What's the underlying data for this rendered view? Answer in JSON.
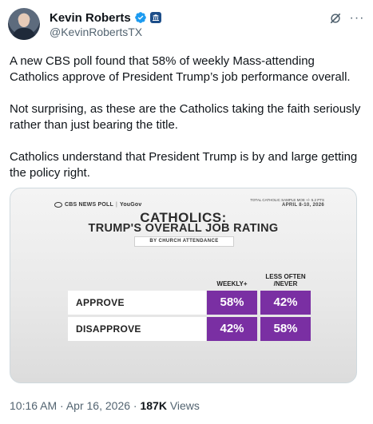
{
  "author": {
    "name": "Kevin Roberts",
    "handle": "@KevinRobertsTX"
  },
  "tweet": {
    "paragraphs": [
      "A new CBS poll found that 58% of weekly Mass-attending Catholics approve of President Trump’s job performance overall.",
      "Not surprising, as these are the Catholics taking the faith seriously rather than just bearing the title.",
      "Catholics understand that President Trump is by and large getting the policy right."
    ]
  },
  "media": {
    "brand": "CBS NEWS POLL",
    "brand_separator": "|",
    "partner": "YouGov",
    "moe": "TOTAL CATHOLIC SAMPLE MOE +/- 5.2 PTS",
    "date": "APRIL 8-10, 2026",
    "title_line1": "CATHOLICS:",
    "title_line2": "TRUMP'S OVERALL JOB RATING",
    "subtitle": "BY CHURCH ATTENDANCE",
    "columns": [
      "WEEKLY+",
      "LESS OFTEN /NEVER"
    ],
    "rows": [
      {
        "label": "APPROVE",
        "values": [
          "58%",
          "42%"
        ]
      },
      {
        "label": "DISAPPROVE",
        "values": [
          "42%",
          "58%"
        ]
      }
    ],
    "cell_color": "#7a2fa3"
  },
  "footer": {
    "time": "10:16 AM",
    "separator": "·",
    "date": "Apr 16, 2026",
    "views_count": "187K",
    "views_label": "Views"
  },
  "icons": {
    "verified": "verified-badge-icon",
    "government": "government-badge-icon",
    "grok": "grok-icon",
    "more": "more-icon"
  },
  "colors": {
    "verified": "#1d9bf0",
    "muted_text": "#536471"
  }
}
